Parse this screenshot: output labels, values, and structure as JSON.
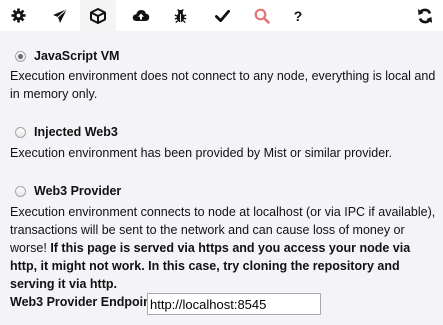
{
  "toolbar": {
    "icons": [
      "gear-icon",
      "send-icon",
      "cube-icon",
      "cloud-upload-icon",
      "bug-icon",
      "check-icon",
      "search-icon",
      "help-icon",
      "sync-icon"
    ],
    "help_glyph": "?",
    "accent": "#e57373"
  },
  "environment": {
    "options": [
      {
        "label": "JavaScript VM",
        "selected": true,
        "description": "Execution environment does not connect to any node, everything is local and in memory only."
      },
      {
        "label": "Injected Web3",
        "selected": false,
        "description": "Execution environment has been provided by Mist or similar provider."
      },
      {
        "label": "Web3 Provider",
        "selected": false,
        "description": "Execution environment connects to node at localhost (or via IPC if available), transactions will be sent to the network and can cause loss of money or worse!",
        "warning": "If this page is served via https and you access your node via http, it might not work. In this case, try cloning the repository and serving it via http."
      }
    ]
  },
  "endpoint": {
    "label": "Web3 Provider Endpoint:",
    "value": "http://localhost:8545"
  }
}
